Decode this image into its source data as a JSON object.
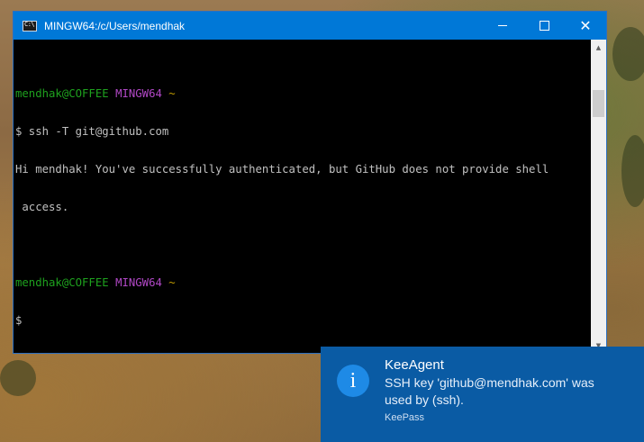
{
  "window": {
    "title": "MINGW64:/c/Users/mendhak",
    "icon": "console-icon",
    "icon_glyph": "C:\\",
    "controls": {
      "minimize": "minimize-icon",
      "maximize": "maximize-icon",
      "close": "close-icon"
    },
    "close_glyph": "✕"
  },
  "terminal": {
    "prompt1": {
      "user_host": "mendhak@COFFEE",
      "env": "MINGW64",
      "path": "~"
    },
    "command": "$ ssh -T git@github.com",
    "output_line1": "Hi mendhak! You've successfully authenticated, but GitHub does not provide shell",
    "output_line2": " access.",
    "prompt2": {
      "user_host": "mendhak@COFFEE",
      "env": "MINGW64",
      "path": "~"
    },
    "cursor_line": "$",
    "colors": {
      "user_host": "#1ea11e",
      "env": "#b148c6",
      "path": "#c19c00",
      "text": "#c0c0c0"
    }
  },
  "scrollbar": {
    "up": "▲",
    "down": "▼"
  },
  "toast": {
    "icon": "info-icon",
    "icon_glyph": "i",
    "title": "KeeAgent",
    "body": "SSH key 'github@mendhak.com' was used by  (ssh).",
    "source": "KeePass",
    "background": "#0a5ba4"
  }
}
